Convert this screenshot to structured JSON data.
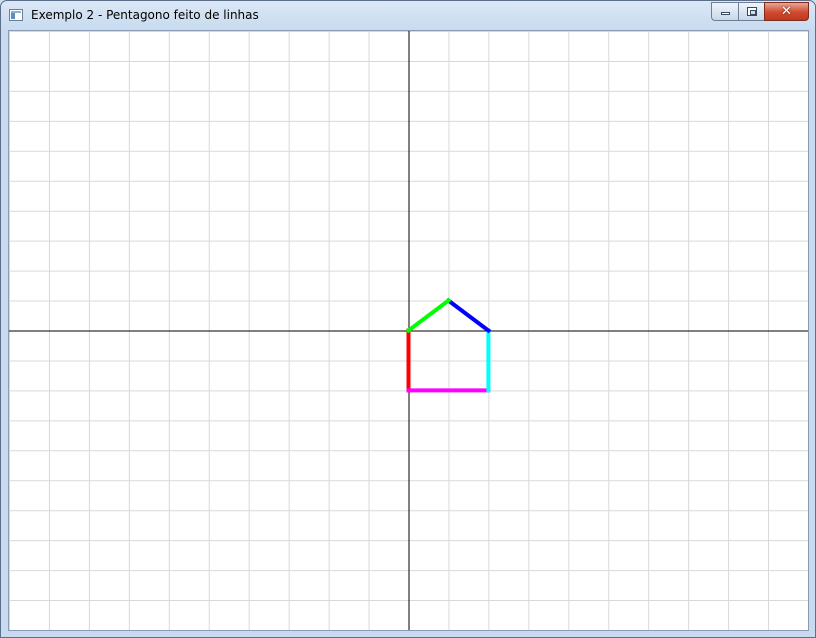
{
  "window": {
    "title": "Exemplo 2 - Pentagono feito de linhas",
    "icon": "application-window-icon",
    "controls": {
      "minimize": "minimize-icon",
      "maximize": "maximize-icon",
      "close_symbol": "✕"
    }
  },
  "canvas": {
    "background": "#ffffff",
    "grid": true,
    "grid_color": "#d9d9d9",
    "axes_color": "#000000",
    "x_range": [
      -10,
      10
    ],
    "y_range": [
      -10,
      10
    ],
    "grid_step": 1
  },
  "pentagon": {
    "edges": [
      {
        "name": "left-edge",
        "color": "#ff0000",
        "from": [
          0,
          0
        ],
        "to": [
          0,
          -2
        ]
      },
      {
        "name": "bottom-edge",
        "color": "#ff00ff",
        "from": [
          0,
          -2
        ],
        "to": [
          2,
          -2
        ]
      },
      {
        "name": "right-edge",
        "color": "#00ffff",
        "from": [
          2,
          -2
        ],
        "to": [
          2,
          0
        ]
      },
      {
        "name": "top-right-edge",
        "color": "#0000ff",
        "from": [
          2,
          0
        ],
        "to": [
          1,
          1
        ]
      },
      {
        "name": "top-left-edge",
        "color": "#00ff00",
        "from": [
          1,
          1
        ],
        "to": [
          0,
          0
        ]
      }
    ]
  }
}
